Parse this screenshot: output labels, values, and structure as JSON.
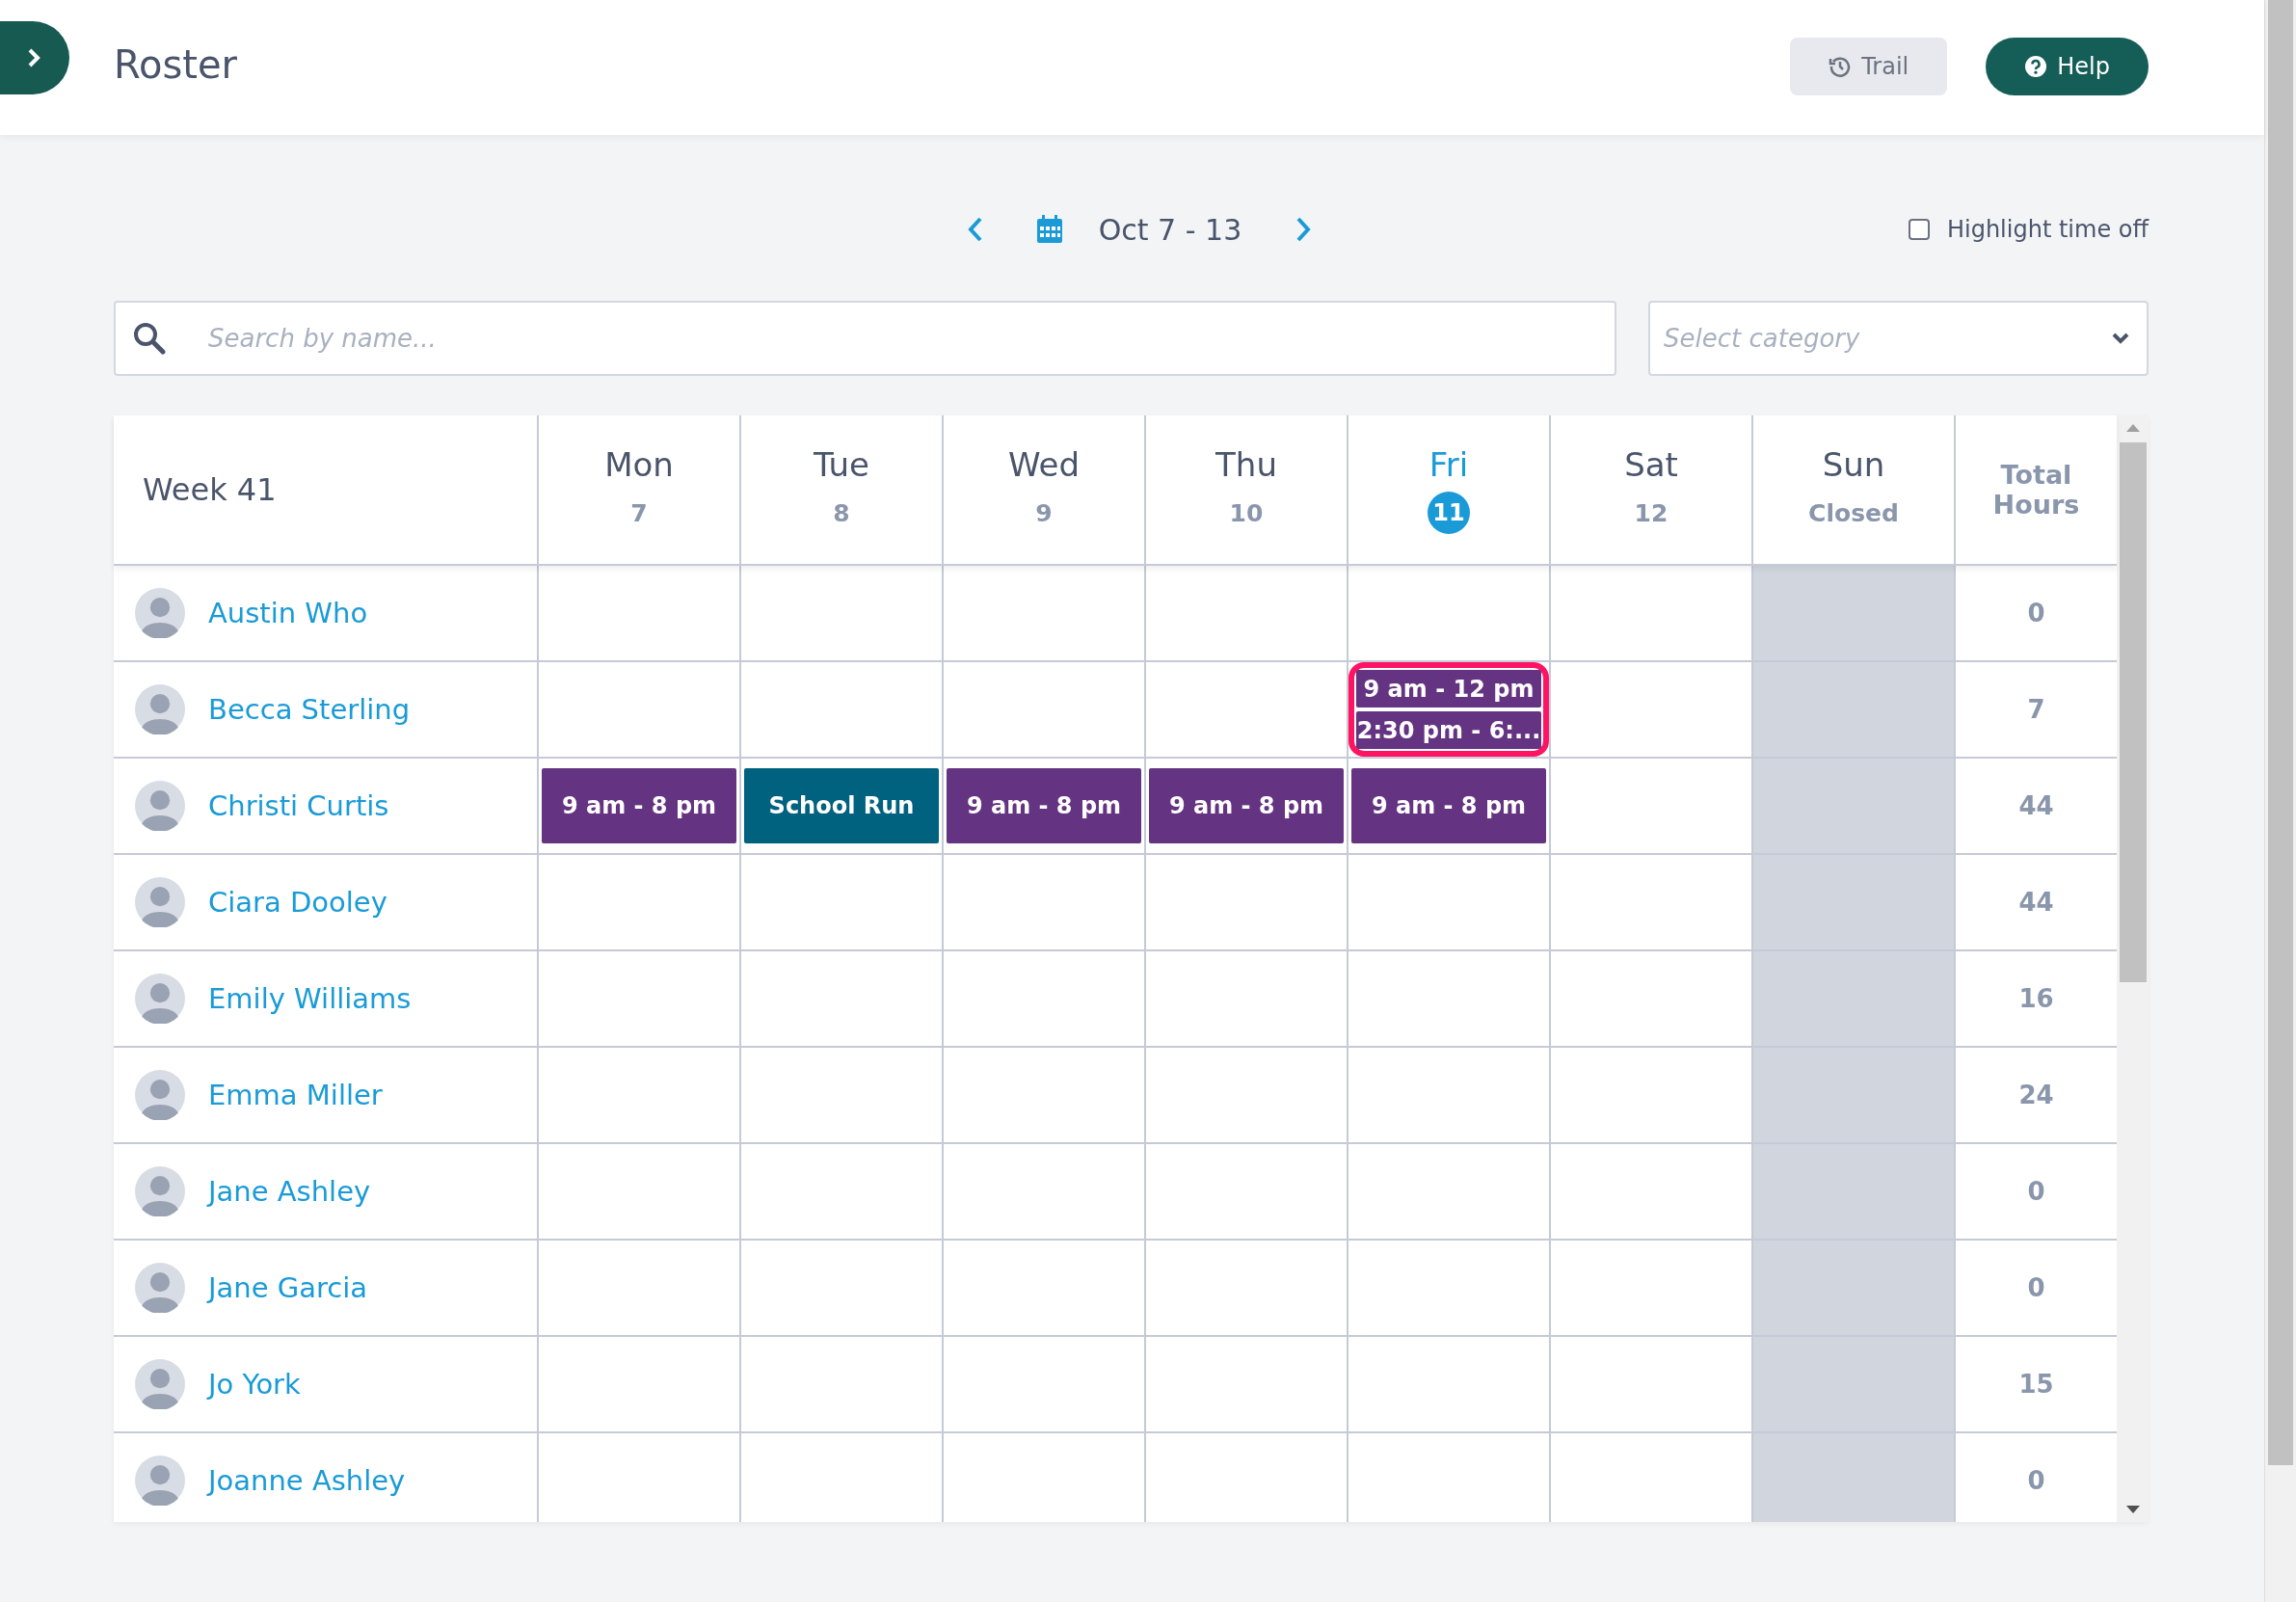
{
  "header": {
    "title": "Roster",
    "buttons": [
      {
        "label": "Trail",
        "kind": "secondary"
      },
      {
        "label": "Help",
        "kind": "primary"
      }
    ]
  },
  "week_nav": {
    "range": "Oct 7 - 13",
    "highlight_time_off": {
      "label": "Highlight time off",
      "checked": false
    }
  },
  "filters": {
    "search": {
      "placeholder": "Search by name..."
    },
    "category": {
      "placeholder": "Select category"
    }
  },
  "table": {
    "week": "Week 41",
    "total_header": "Total Hours",
    "columns": [
      {
        "day": "Mon",
        "sub": "7",
        "today": false,
        "closed": false
      },
      {
        "day": "Tue",
        "sub": "8",
        "today": false,
        "closed": false
      },
      {
        "day": "Wed",
        "sub": "9",
        "today": false,
        "closed": false
      },
      {
        "day": "Thu",
        "sub": "10",
        "today": false,
        "closed": false
      },
      {
        "day": "Fri",
        "sub": "11",
        "today": true,
        "closed": false
      },
      {
        "day": "Sat",
        "sub": "12",
        "today": false,
        "closed": false
      },
      {
        "day": "Sun",
        "sub": "Closed",
        "today": false,
        "closed": true
      }
    ],
    "rows": [
      {
        "name": "Austin Who",
        "total": "0",
        "cells": [
          {
            "selected": false
          },
          {
            "selected": false
          },
          {
            "selected": false
          },
          {
            "selected": false
          },
          {
            "selected": false
          },
          {
            "selected": false
          },
          {
            "selected": false
          }
        ]
      },
      {
        "name": "Becca Sterling",
        "total": "7",
        "cells": [
          {
            "selected": false
          },
          {
            "selected": false
          },
          {
            "selected": false
          },
          {
            "selected": false
          },
          {
            "selected": true,
            "shifts": [
              {
                "label": "9 am - 12 pm",
                "kind": "shift"
              },
              {
                "label": "2:30 pm - 6:...",
                "kind": "shift"
              }
            ]
          },
          {
            "selected": false
          },
          {
            "selected": false
          }
        ]
      },
      {
        "name": "Christi Curtis",
        "total": "44",
        "cells": [
          {
            "selected": false,
            "shifts": [
              {
                "label": "9 am - 8 pm",
                "kind": "shift"
              }
            ]
          },
          {
            "selected": false,
            "shifts": [
              {
                "label": "School Run",
                "kind": "event"
              }
            ]
          },
          {
            "selected": false,
            "shifts": [
              {
                "label": "9 am - 8 pm",
                "kind": "shift"
              }
            ]
          },
          {
            "selected": false,
            "shifts": [
              {
                "label": "9 am - 8 pm",
                "kind": "shift"
              }
            ]
          },
          {
            "selected": false,
            "shifts": [
              {
                "label": "9 am - 8 pm",
                "kind": "shift"
              }
            ]
          },
          {
            "selected": false
          },
          {
            "selected": false
          }
        ]
      },
      {
        "name": "Ciara Dooley",
        "total": "44",
        "cells": [
          {
            "selected": false
          },
          {
            "selected": false
          },
          {
            "selected": false
          },
          {
            "selected": false
          },
          {
            "selected": false
          },
          {
            "selected": false
          },
          {
            "selected": false
          }
        ]
      },
      {
        "name": "Emily Williams",
        "total": "16",
        "cells": [
          {
            "selected": false
          },
          {
            "selected": false
          },
          {
            "selected": false
          },
          {
            "selected": false
          },
          {
            "selected": false
          },
          {
            "selected": false
          },
          {
            "selected": false
          }
        ]
      },
      {
        "name": "Emma Miller",
        "total": "24",
        "cells": [
          {
            "selected": false
          },
          {
            "selected": false
          },
          {
            "selected": false
          },
          {
            "selected": false
          },
          {
            "selected": false
          },
          {
            "selected": false
          },
          {
            "selected": false
          }
        ]
      },
      {
        "name": "Jane Ashley",
        "total": "0",
        "cells": [
          {
            "selected": false
          },
          {
            "selected": false
          },
          {
            "selected": false
          },
          {
            "selected": false
          },
          {
            "selected": false
          },
          {
            "selected": false
          },
          {
            "selected": false
          }
        ]
      },
      {
        "name": "Jane Garcia",
        "total": "0",
        "cells": [
          {
            "selected": false
          },
          {
            "selected": false
          },
          {
            "selected": false
          },
          {
            "selected": false
          },
          {
            "selected": false
          },
          {
            "selected": false
          },
          {
            "selected": false
          }
        ]
      },
      {
        "name": "Jo York",
        "total": "15",
        "cells": [
          {
            "selected": false
          },
          {
            "selected": false
          },
          {
            "selected": false
          },
          {
            "selected": false
          },
          {
            "selected": false
          },
          {
            "selected": false
          },
          {
            "selected": false
          }
        ]
      },
      {
        "name": "Joanne Ashley",
        "total": "0",
        "cells": [
          {
            "selected": false
          },
          {
            "selected": false
          },
          {
            "selected": false
          },
          {
            "selected": false
          },
          {
            "selected": false
          },
          {
            "selected": false
          },
          {
            "selected": false
          }
        ]
      }
    ]
  }
}
